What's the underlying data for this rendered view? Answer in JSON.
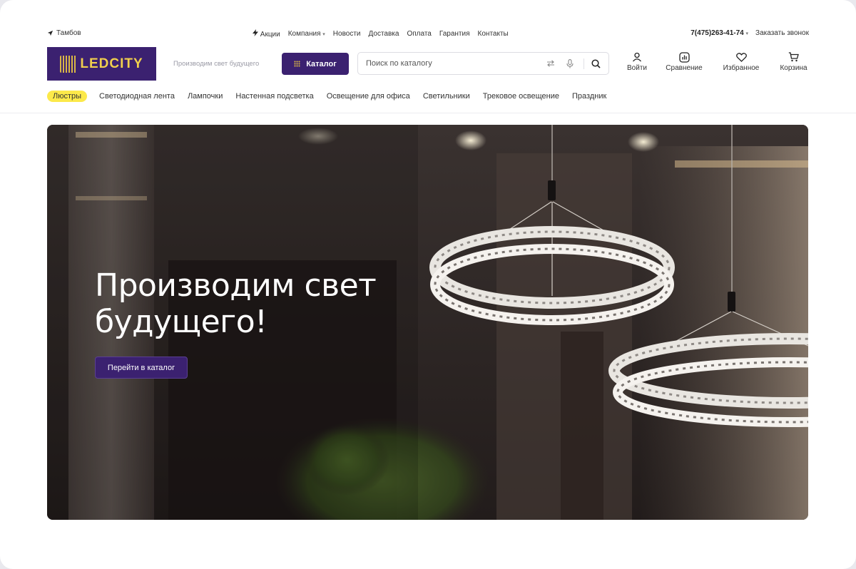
{
  "topbar": {
    "city": "Тамбов",
    "nav": [
      {
        "label": "Акции"
      },
      {
        "label": "Компания"
      },
      {
        "label": "Новости"
      },
      {
        "label": "Доставка"
      },
      {
        "label": "Оплата"
      },
      {
        "label": "Гарантия"
      },
      {
        "label": "Контакты"
      }
    ],
    "phone": "7(475)263-41-74",
    "callback": "Заказать звонок"
  },
  "header": {
    "logo_text": "LEDCITY",
    "tagline": "Производим свет будущего",
    "catalog_button": "Каталог",
    "search_placeholder": "Поиск по каталогу",
    "actions": [
      {
        "label": "Войти",
        "icon": "user-icon"
      },
      {
        "label": "Сравнение",
        "icon": "compare-icon"
      },
      {
        "label": "Избранное",
        "icon": "heart-icon"
      },
      {
        "label": "Корзина",
        "icon": "cart-icon"
      }
    ]
  },
  "categories": [
    "Люстры",
    "Светодиодная лента",
    "Лампочки",
    "Настенная подсветка",
    "Освещение для офиса",
    "Светильники",
    "Трековое освещение",
    "Праздник"
  ],
  "hero": {
    "title": "Производим свет будущего!",
    "button": "Перейти в каталог"
  },
  "colors": {
    "brand": "#3b2170",
    "accent": "#f0cf4d",
    "active_category": "#fce94a"
  }
}
